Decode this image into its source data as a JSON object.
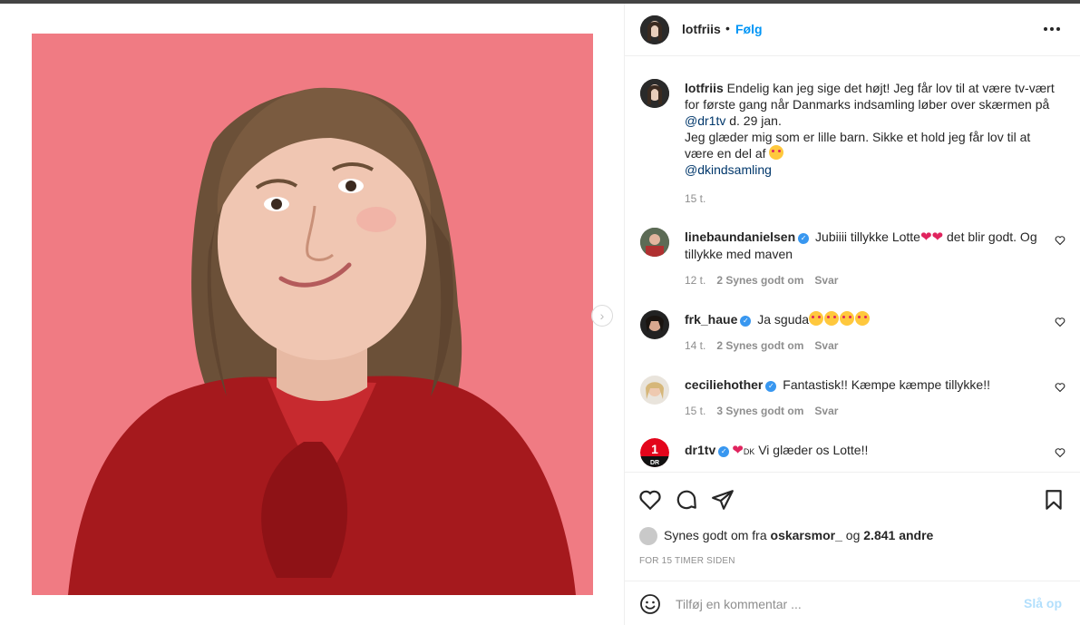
{
  "post": {
    "author": "lotfriis",
    "follow_label": "Følg",
    "dot": "•"
  },
  "caption": {
    "username": "lotfriis",
    "text_1": " Endelig kan jeg sige det højt! Jeg får lov til at være tv-vært for første gang når Danmarks indsamling løber over skærmen på ",
    "mention_1": "@dr1tv",
    "text_2": " d. 29 jan.",
    "text_3": "Jeg glæder mig som er lille barn. Sikke et hold jeg får lov til at være en del af ",
    "mention_2": "@dkindsamling",
    "time": "15 t."
  },
  "comments": [
    {
      "username": "linebaundanielsen",
      "text_a": " Jubiiii tillykke Lotte",
      "text_b": " det blir godt. Og tillykke med maven",
      "time": "12 t.",
      "likes": "2 Synes godt om",
      "reply": "Svar"
    },
    {
      "username": "frk_haue",
      "text_a": " Ja sguda",
      "time": "14 t.",
      "likes": "2 Synes godt om",
      "reply": "Svar"
    },
    {
      "username": "ceciliehother",
      "text_a": " Fantastisk!! Kæmpe kæmpe tillykke!!",
      "time": "15 t.",
      "likes": "3 Synes godt om",
      "reply": "Svar"
    },
    {
      "username": "dr1tv",
      "text_a": " Vi glæder os Lotte!!",
      "flag": "DK"
    }
  ],
  "likes": {
    "prefix": "Synes godt om fra ",
    "user": "oskarsmor_",
    "middle": " og ",
    "count": "2.841 andre"
  },
  "time_ago": "FOR 15 TIMER SIDEN",
  "add_comment": {
    "placeholder": "Tilføj en kommentar ...",
    "post_label": "Slå op"
  },
  "icons": [
    "heart-icon",
    "comment-icon",
    "share-icon",
    "bookmark-icon",
    "emoji-icon",
    "more-icon",
    "verified-icon",
    "chevron-right-icon"
  ],
  "colors": {
    "accent": "#0095f6",
    "photo_bg": "#f07b83",
    "link": "#00376b",
    "verified": "#3897f0"
  }
}
